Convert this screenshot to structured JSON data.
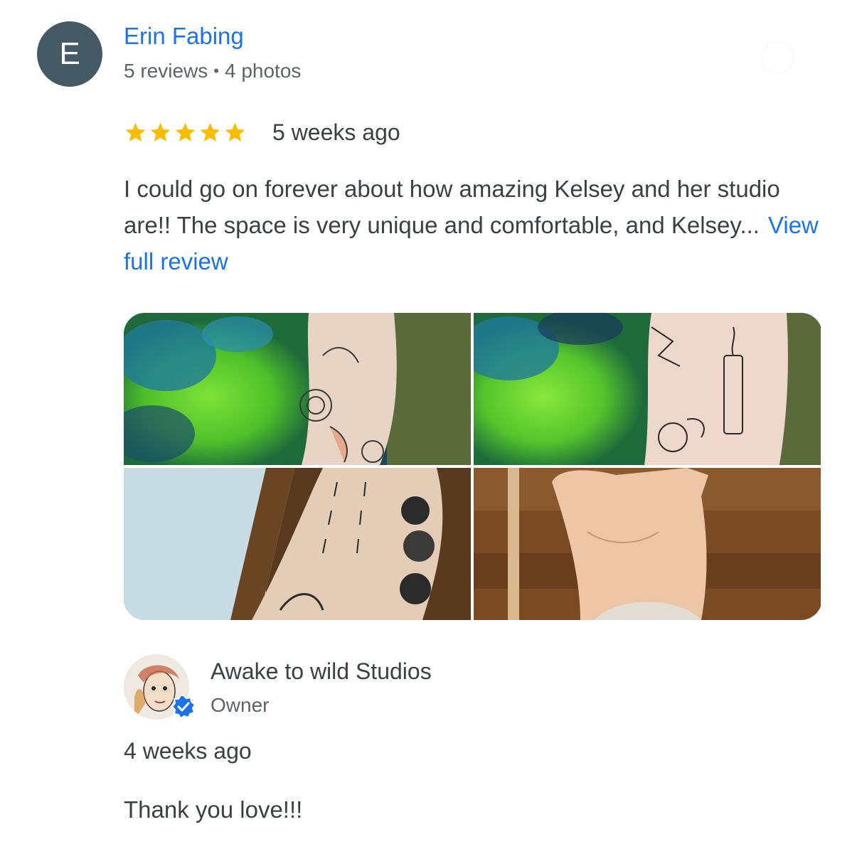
{
  "reviewer": {
    "initial": "E",
    "name": "Erin Fabing",
    "reviews_count": "5 reviews",
    "separator": "•",
    "photos_count": "4 photos"
  },
  "review": {
    "rating": 5,
    "max_rating": 5,
    "date": "5 weeks ago",
    "text": "I could go on forever about how amazing Kelsey and her studio are!! The space is very unique and comfortable, and Kelsey...",
    "view_full_label": "View full review"
  },
  "photos": [
    {
      "icon": "tattoo-photo-1"
    },
    {
      "icon": "tattoo-photo-2"
    },
    {
      "icon": "tattoo-photo-3"
    },
    {
      "icon": "tattoo-photo-4"
    }
  ],
  "owner_reply": {
    "name": "Awake to wild Studios",
    "role": "Owner",
    "date": "4 weeks ago",
    "text": "Thank you love!!!"
  },
  "colors": {
    "link": "#1a73e8",
    "star": "#fbbc04",
    "avatar_bg": "#455a64",
    "verified": "#1a73e8"
  }
}
